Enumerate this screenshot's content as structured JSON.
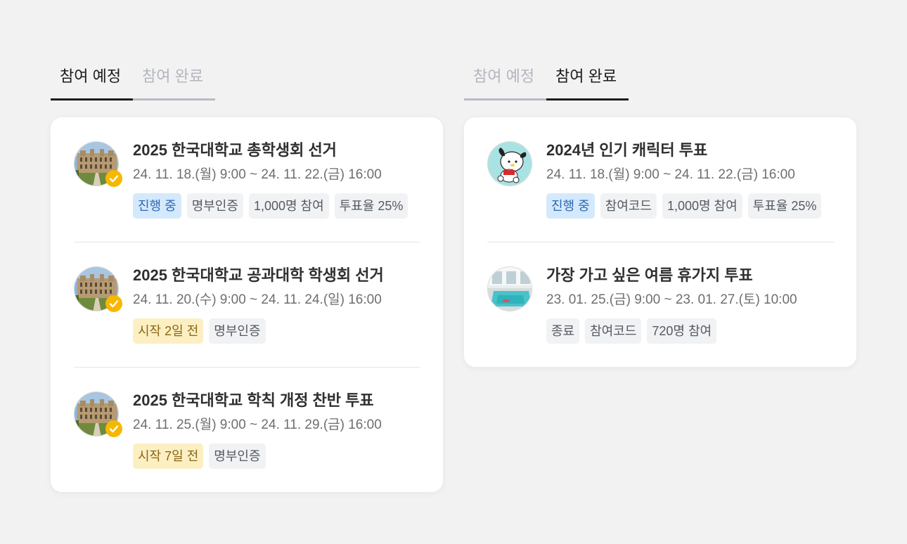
{
  "left": {
    "tabs": [
      {
        "label": "참여 예정",
        "active": true
      },
      {
        "label": "참여 완료",
        "active": false
      }
    ],
    "items": [
      {
        "title": "2025 한국대학교 총학생회 선거",
        "date": "24. 11. 18.(월) 9:00 ~ 24. 11. 22.(금) 16:00",
        "tags": [
          {
            "label": "진행 중",
            "kind": "live"
          },
          {
            "label": "명부인증",
            "kind": "neutral"
          },
          {
            "label": "1,000명 참여",
            "kind": "neutral"
          },
          {
            "label": "투표율 25%",
            "kind": "neutral"
          }
        ]
      },
      {
        "title": "2025 한국대학교 공과대학 학생회 선거",
        "date": "24. 11. 20.(수) 9:00 ~ 24. 11. 24.(일) 16:00",
        "tags": [
          {
            "label": "시작 2일 전",
            "kind": "soon"
          },
          {
            "label": "명부인증",
            "kind": "neutral"
          }
        ]
      },
      {
        "title": "2025 한국대학교 학칙 개정 찬반 투표",
        "date": "24. 11. 25.(월) 9:00 ~ 24. 11. 29.(금) 16:00",
        "tags": [
          {
            "label": "시작 7일 전",
            "kind": "soon"
          },
          {
            "label": "명부인증",
            "kind": "neutral"
          }
        ]
      }
    ]
  },
  "right": {
    "tabs": [
      {
        "label": "참여 예정",
        "active": false
      },
      {
        "label": "참여 완료",
        "active": true
      }
    ],
    "items": [
      {
        "title": "2024년 인기 캐릭터 투표",
        "date": "24. 11. 18.(월) 9:00 ~ 24. 11. 22.(금) 16:00",
        "tags": [
          {
            "label": "진행 중",
            "kind": "live"
          },
          {
            "label": "참여코드",
            "kind": "neutral"
          },
          {
            "label": "1,000명 참여",
            "kind": "neutral"
          },
          {
            "label": "투표율 25%",
            "kind": "neutral"
          }
        ]
      },
      {
        "title": "가장 가고 싶은 여름 휴가지 투표",
        "date": "23. 01. 25.(금) 9:00 ~ 23. 01. 27.(토) 10:00",
        "tags": [
          {
            "label": "종료",
            "kind": "neutral"
          },
          {
            "label": "참여코드",
            "kind": "neutral"
          },
          {
            "label": "720명 참여",
            "kind": "neutral"
          }
        ]
      }
    ]
  },
  "colors": {
    "live_bg": "#d4e9fb",
    "live_text": "#2d69b3",
    "soon_bg": "#fcefc2",
    "soon_text": "#8a6516",
    "verified_badge": "#f5b800"
  }
}
